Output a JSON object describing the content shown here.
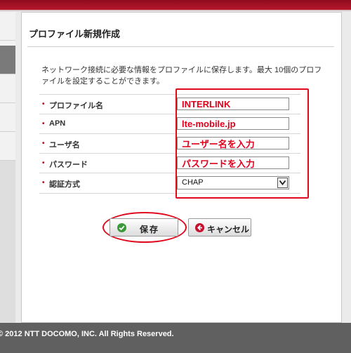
{
  "page": {
    "title": "プロファイル新規作成",
    "description": "ネットワーク接続に必要な情報をプロファイルに保存します。最大 10個のプロファイルを設定することができます。"
  },
  "form": {
    "profile_name": {
      "label": "プロファイル名",
      "value": "INTERLINK"
    },
    "apn": {
      "label": "APN",
      "value": "lte-mobile.jp"
    },
    "username": {
      "label": "ユーザ名",
      "value": "ユーザー名を入力"
    },
    "password": {
      "label": "パスワード",
      "value": "パスワードを入力"
    },
    "auth_method": {
      "label": "認証方式",
      "selected": "CHAP"
    },
    "bullet": "•"
  },
  "buttons": {
    "save": "保存",
    "cancel": "キャンセル"
  },
  "footer": {
    "copyright": "© 2012 NTT DOCOMO, INC. All Rights Reserved."
  },
  "colors": {
    "accent_red": "#e00a1e",
    "brand_bar": "#b8162c",
    "save_icon": "#3a9a3a",
    "cancel_icon": "#c8102e"
  },
  "icons": {
    "save": "check-circle-icon",
    "cancel": "arrow-left-circle-icon",
    "select": "chevron-down-icon"
  }
}
